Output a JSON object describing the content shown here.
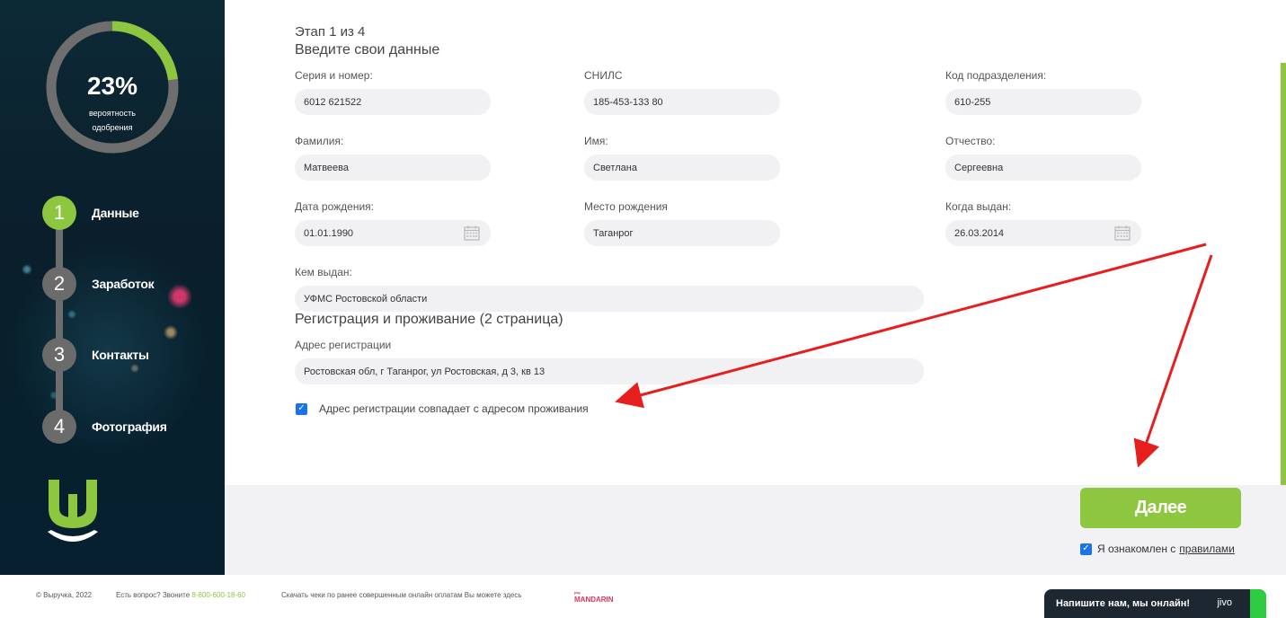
{
  "sidebar": {
    "approval_percent": "23%",
    "approval_caption_line1": "вероятность",
    "approval_caption_line2": "одобрения",
    "approval_fraction": 0.23,
    "steps": [
      {
        "num": "1",
        "label": "Данные",
        "active": true
      },
      {
        "num": "2",
        "label": "Заработок",
        "active": false
      },
      {
        "num": "3",
        "label": "Контакты",
        "active": false
      },
      {
        "num": "4",
        "label": "Фотография",
        "active": false
      }
    ]
  },
  "form": {
    "stage": "Этап 1 из 4",
    "subtitle": "Введите свои данные",
    "fields": {
      "passport": {
        "label": "Серия и номер:",
        "value": "6012 621522"
      },
      "snils": {
        "label": "СНИЛС",
        "value": "185-453-133 80"
      },
      "dept_code": {
        "label": "Код подразделения:",
        "value": "610-255"
      },
      "surname": {
        "label": "Фамилия:",
        "value": "Матвеева"
      },
      "name": {
        "label": "Имя:",
        "value": "Светлана"
      },
      "patronymic": {
        "label": "Отчество:",
        "value": "Сергеевна"
      },
      "birth_date": {
        "label": "Дата рождения:",
        "value": "01.01.1990"
      },
      "birth_place": {
        "label": "Место рождения",
        "value": "Таганрог"
      },
      "issue_date": {
        "label": "Когда выдан:",
        "value": "26.03.2014"
      },
      "issued_by": {
        "label": "Кем выдан:",
        "value": "УФМС Ростовской области"
      }
    },
    "section2_title": "Регистрация и проживание (2 страница)",
    "reg_address": {
      "label": "Адрес регистрации",
      "value": "Ростовская обл, г Таганрог, ул Ростовская, д 3, кв 13"
    },
    "same_address_label": "Адрес регистрации совпадает с адресом проживания",
    "same_address_checked": true
  },
  "actions": {
    "next_label": "Далее",
    "agree_label": "Я ознакомлен с",
    "agree_link": "правилами",
    "agree_checked": true
  },
  "footer": {
    "copyright": "© Выручка, 2022",
    "question": "Есть вопрос? Звоните",
    "phone": "8-800-600-18-60",
    "receipts": "Скачать чеки по ранее совершенным онлайн оплатам Вы можете здесь",
    "mandarin_small": "pay",
    "mandarin": "MANDARIN"
  },
  "chat": {
    "text": "Напишите нам, мы онлайн!",
    "brand": "jivo"
  },
  "colors": {
    "accent_green": "#8dc63f",
    "arrow_red": "#e61e1e",
    "checkbox_blue": "#1a73e8",
    "chat_bg": "#1c2732"
  }
}
